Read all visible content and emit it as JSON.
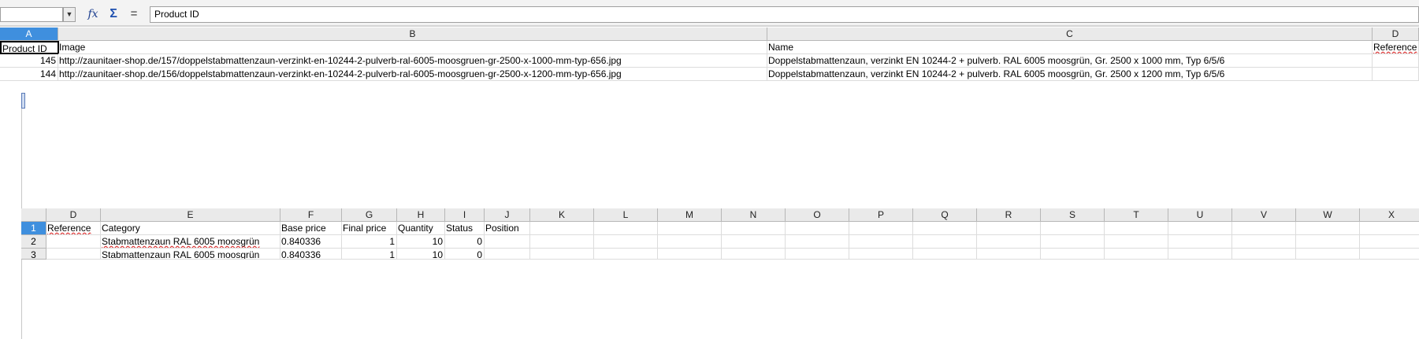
{
  "formula_bar": {
    "name_box": "",
    "content": "Product ID",
    "fx_icon": "function-wizard-icon",
    "sum_icon": "sum-icon",
    "equals_icon": "equals-icon"
  },
  "sheet_top": {
    "columns": [
      "A",
      "B",
      "C",
      "D"
    ],
    "rows": [
      [
        "Product ID",
        "Image",
        "Name",
        "Reference"
      ],
      [
        "145",
        "http://zaunitaer-shop.de/157/doppelstabmattenzaun-verzinkt-en-10244-2-pulverb-ral-6005-moosgruen-gr-2500-x-1000-mm-typ-656.jpg",
        "Doppelstabmattenzaun, verzinkt EN 10244-2 + pulverb. RAL 6005 moosgrün, Gr. 2500 x 1000 mm, Typ 6/5/6",
        ""
      ],
      [
        "144",
        "http://zaunitaer-shop.de/156/doppelstabmattenzaun-verzinkt-en-10244-2-pulverb-ral-6005-moosgruen-gr-2500-x-1200-mm-typ-656.jpg",
        "Doppelstabmattenzaun, verzinkt EN 10244-2 + pulverb. RAL 6005 moosgrün, Gr. 2500 x 1200 mm, Typ 6/5/6",
        ""
      ]
    ]
  },
  "sheet_bottom": {
    "columns": [
      "D",
      "E",
      "F",
      "G",
      "H",
      "I",
      "J",
      "K",
      "L",
      "M",
      "N",
      "O",
      "P",
      "Q",
      "R",
      "S",
      "T",
      "U",
      "V",
      "W",
      "X"
    ],
    "row_numbers": [
      "1",
      "2",
      "3"
    ],
    "rows": [
      [
        "Reference",
        "Category",
        "Base price",
        "Final price",
        "Quantity",
        "Status",
        "Position"
      ],
      [
        "",
        "Stabmattenzaun RAL 6005 moosgrün",
        "0.840336",
        "1",
        "10",
        "0",
        ""
      ],
      [
        "",
        "Stabmattenzaun RAL 6005 moosgrün",
        "0.840336",
        "1",
        "10",
        "0",
        ""
      ]
    ]
  },
  "colors": {
    "selected_header": "#3f8fde",
    "header_bg": "#eaeaea",
    "spell_underline": "#d33"
  }
}
